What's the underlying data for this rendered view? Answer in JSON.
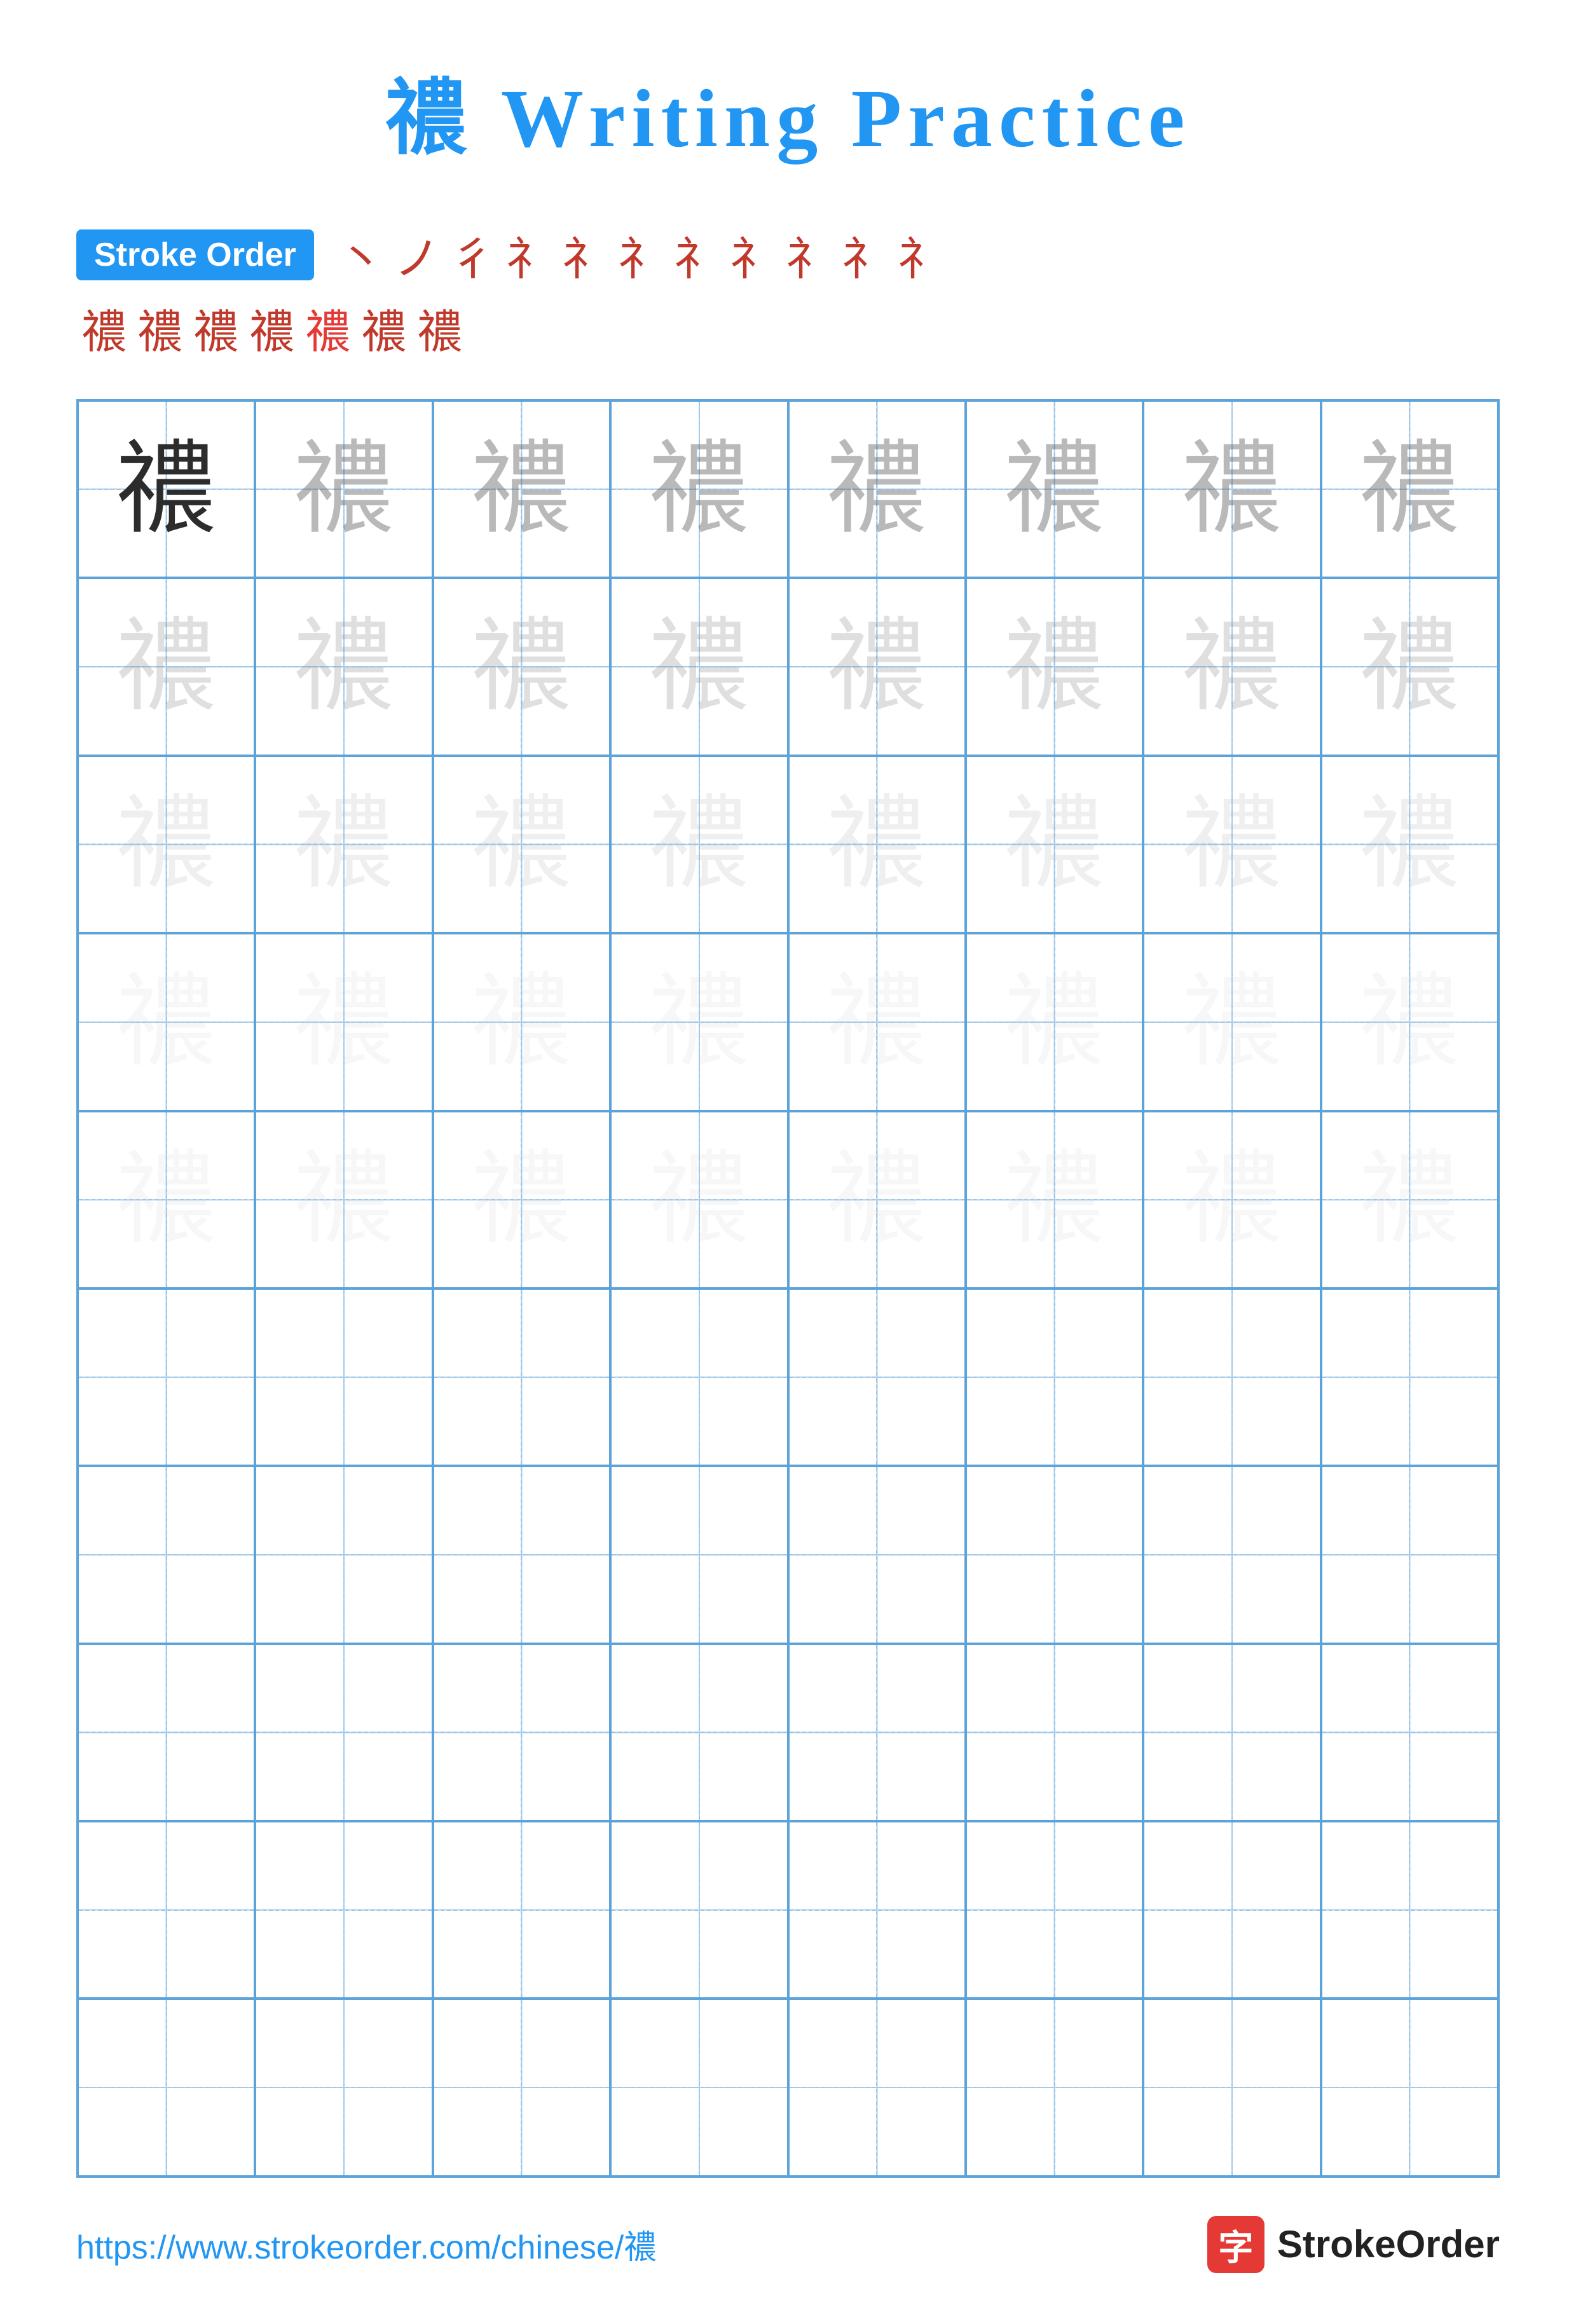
{
  "title": {
    "char": "禯",
    "text": " Writing Practice"
  },
  "stroke_order": {
    "badge_label": "Stroke Order",
    "strokes_row1": [
      "丶",
      "ノ",
      "彳",
      "彳",
      "礻",
      "礻",
      "礻",
      "礻˙",
      "礻丨",
      "礻丨",
      "礻丨"
    ],
    "strokes_row2": [
      "禯",
      "禯",
      "禯",
      "禯",
      "禯",
      "禯",
      "禯"
    ],
    "main_char": "禯"
  },
  "grid": {
    "rows": 10,
    "cols": 8,
    "char": "禯",
    "practice_rows": [
      [
        1,
        2,
        2,
        2,
        2,
        2,
        2,
        2
      ],
      [
        3,
        3,
        3,
        3,
        3,
        3,
        3,
        3
      ],
      [
        4,
        4,
        4,
        4,
        4,
        4,
        4,
        4
      ],
      [
        5,
        5,
        5,
        5,
        5,
        5,
        5,
        5
      ],
      [
        5,
        5,
        5,
        5,
        5,
        5,
        5,
        5
      ],
      [
        0,
        0,
        0,
        0,
        0,
        0,
        0,
        0
      ],
      [
        0,
        0,
        0,
        0,
        0,
        0,
        0,
        0
      ],
      [
        0,
        0,
        0,
        0,
        0,
        0,
        0,
        0
      ],
      [
        0,
        0,
        0,
        0,
        0,
        0,
        0,
        0
      ],
      [
        0,
        0,
        0,
        0,
        0,
        0,
        0,
        0
      ]
    ]
  },
  "footer": {
    "url": "https://www.strokeorder.com/chinese/禯",
    "logo_char": "字",
    "logo_text": "StrokeOrder"
  }
}
